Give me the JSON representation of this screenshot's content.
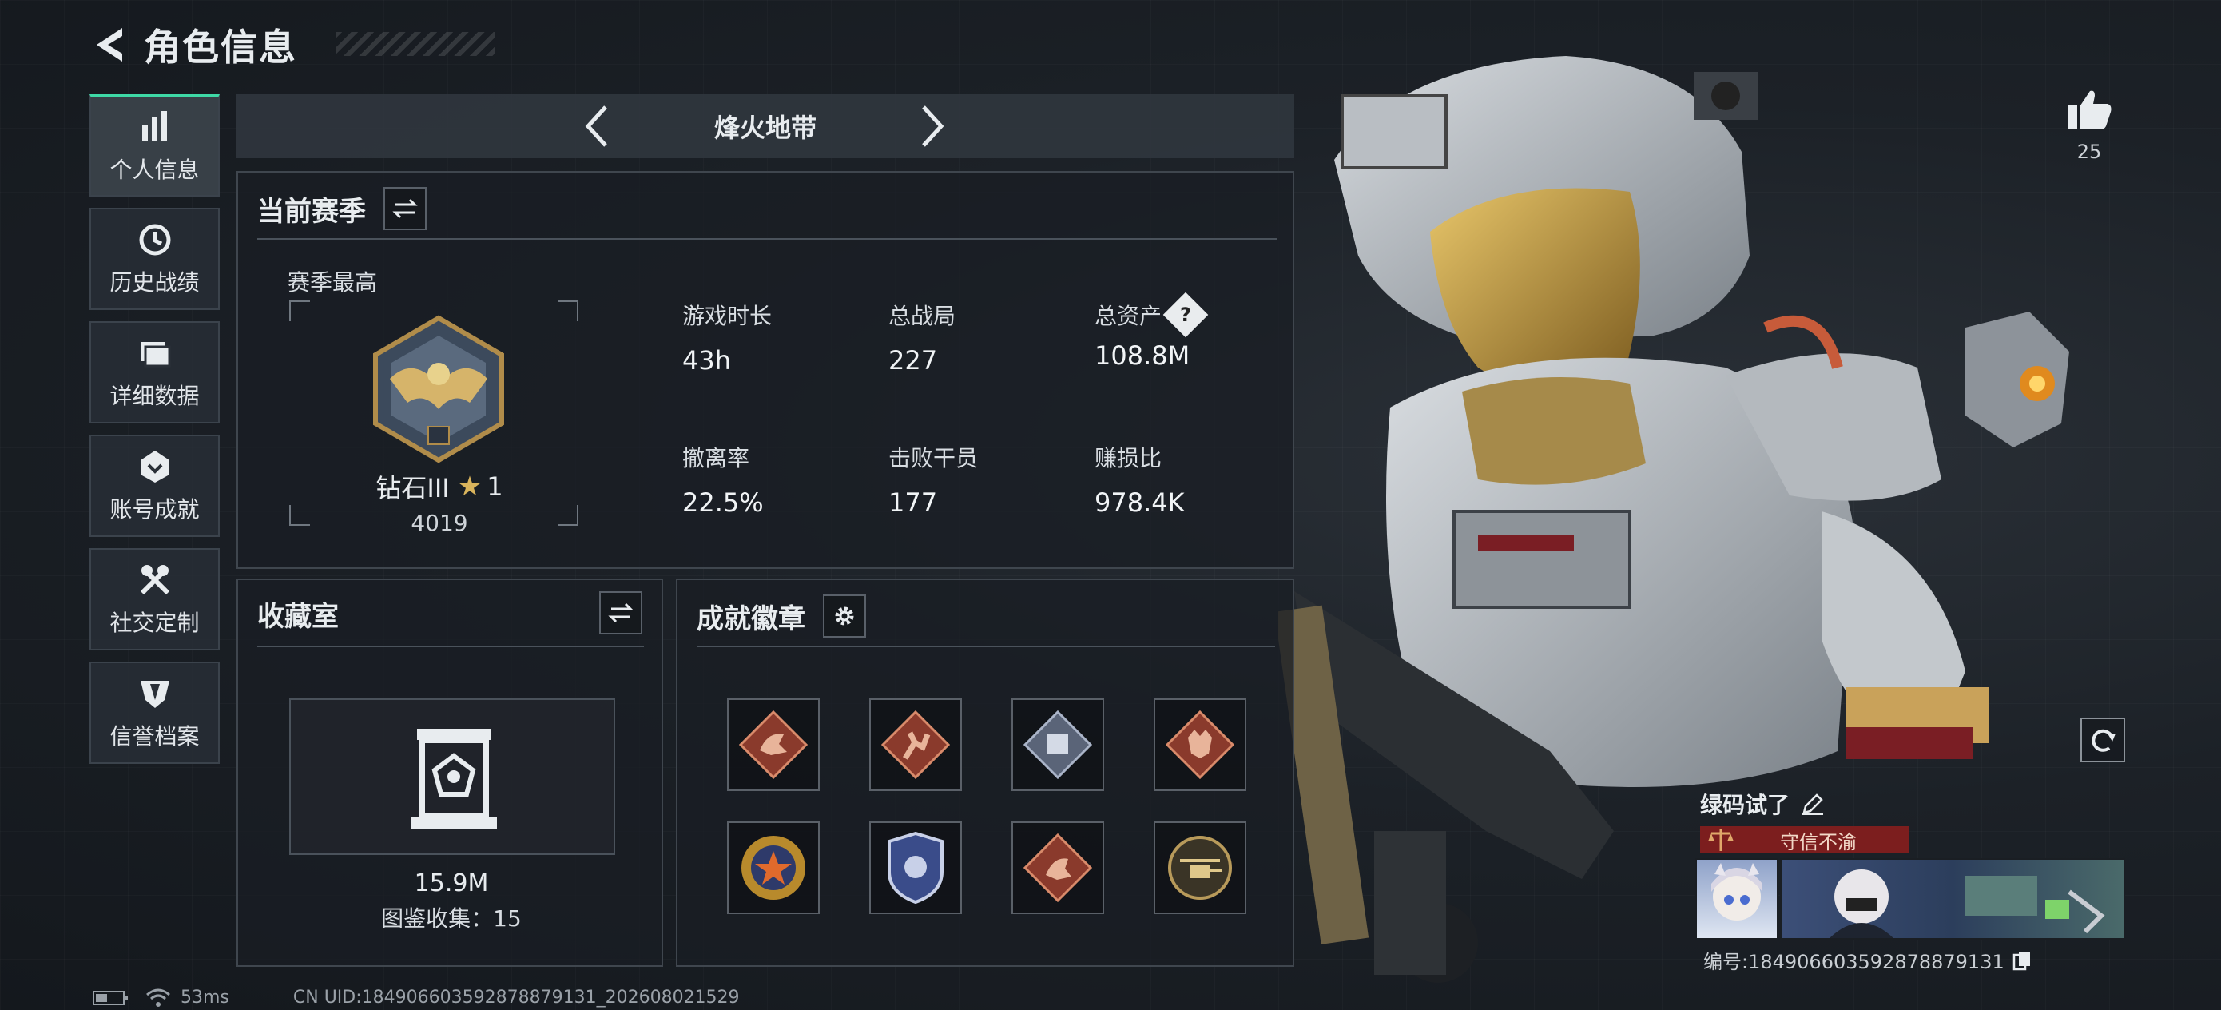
{
  "header": {
    "title": "角色信息"
  },
  "sidebar": {
    "items": [
      {
        "label": "个人信息",
        "icon": "bar-chart-icon",
        "active": true
      },
      {
        "label": "历史战绩",
        "icon": "clock-icon",
        "active": false
      },
      {
        "label": "详细数据",
        "icon": "folder-icon",
        "active": false
      },
      {
        "label": "账号成就",
        "icon": "achievement-icon",
        "active": false
      },
      {
        "label": "社交定制",
        "icon": "tools-icon",
        "active": false
      },
      {
        "label": "信誉档案",
        "icon": "shield-emblem-icon",
        "active": false
      }
    ]
  },
  "mode": {
    "title": "烽火地带"
  },
  "season": {
    "title": "当前赛季",
    "best_label": "赛季最高",
    "rank_name": "钻石III",
    "rank_stars": "1",
    "rank_points": "4019",
    "stats": [
      {
        "label": "游戏时长",
        "value": "43h"
      },
      {
        "label": "总战局",
        "value": "227"
      },
      {
        "label": "总资产",
        "value": "108.8M",
        "help": "?"
      },
      {
        "label": "撤离率",
        "value": "22.5%"
      },
      {
        "label": "击败干员",
        "value": "177"
      },
      {
        "label": "赚损比",
        "value": "978.4K"
      }
    ]
  },
  "collection": {
    "title": "收藏室",
    "value": "15.9M",
    "count_text": "图鉴收集：15"
  },
  "badges": {
    "title": "成就徽章",
    "items": [
      {
        "name": "dragon-badge",
        "color": "#8a3a2c"
      },
      {
        "name": "runner-badge",
        "color": "#8a3a2c"
      },
      {
        "name": "crate-badge",
        "color": "#5a6478"
      },
      {
        "name": "wolf-badge",
        "color": "#8a3a2c"
      },
      {
        "name": "star-medal-badge",
        "color": "#b88a2c"
      },
      {
        "name": "police-badge",
        "color": "#3a4c8a"
      },
      {
        "name": "dragon-badge-2",
        "color": "#8a3a2c"
      },
      {
        "name": "helicopter-badge",
        "color": "#6a5a3a"
      }
    ]
  },
  "profile": {
    "likes": "25",
    "name": "绿码试了",
    "honor": "守信不渝",
    "id_text": "编号:184906603592878879131"
  },
  "status": {
    "ping": "53ms",
    "uid": "CN UID:184906603592878879131_202608021529"
  },
  "colors": {
    "accent": "#3ed9a6",
    "honor_bar": "#7c1e1e",
    "panel_border": "#3f464e"
  }
}
